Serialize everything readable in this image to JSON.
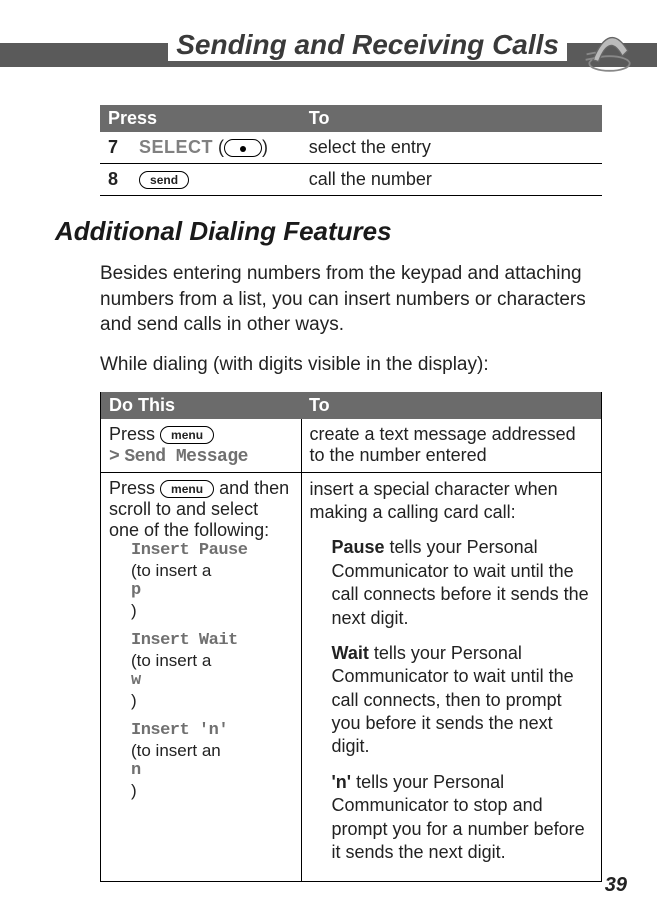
{
  "header": {
    "title": "Sending and Receiving Calls"
  },
  "table1": {
    "headers": {
      "press": "Press",
      "to": "To"
    },
    "row1": {
      "step": "7",
      "label": "SELECT",
      "action": "select the entry"
    },
    "row2": {
      "step": "8",
      "key": "send",
      "action": "call the number"
    }
  },
  "section": {
    "heading": "Additional Dialing Features",
    "intro": "Besides entering numbers from the keypad and attaching numbers from a list, you can insert numbers or characters and send calls in other ways.",
    "intro2": "While dialing (with digits visible in the display):"
  },
  "table2": {
    "headers": {
      "dothis": "Do This",
      "to": "To"
    },
    "row1": {
      "press": "Press",
      "menu": "menu",
      "gt": ">",
      "sendmsg": "Send Message",
      "result": "create a text message addressed to the number entered"
    },
    "row2": {
      "press": "Press",
      "menu": "menu",
      "andthen": "and then scroll to and select one of the following:",
      "items": {
        "pause": {
          "label": "Insert Pause",
          "note_pre": "(to insert a ",
          "char": "p",
          "note_post": ")"
        },
        "wait": {
          "label": "Insert Wait",
          "note_pre": "(to insert a ",
          "char": "w",
          "note_post": ")"
        },
        "n": {
          "label": "Insert 'n'",
          "note_pre": "(to insert an ",
          "char": "n",
          "note_post": ")"
        }
      },
      "desc_intro": "insert a special character when making a calling card call:",
      "pause": {
        "bold": "Pause",
        "text": " tells your Personal Communicator to wait until the call connects before it sends the next digit."
      },
      "wait": {
        "bold": "Wait",
        "text": " tells your Personal Communicator to wait until the call connects, then to prompt you before it sends the next digit."
      },
      "n": {
        "bold": "'n'",
        "text": " tells your Personal Communicator to stop and prompt you for a number before it sends the next digit."
      }
    }
  },
  "page_number": "39"
}
